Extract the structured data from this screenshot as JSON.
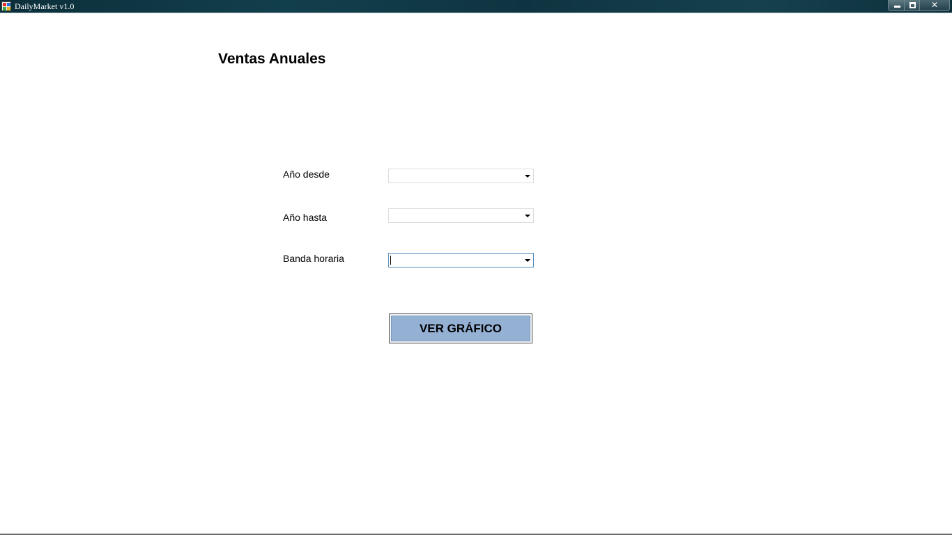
{
  "window": {
    "title": "DailyMarket v1.0",
    "controls": {
      "minimize": "minimize",
      "maximize": "restore",
      "close": "✕"
    }
  },
  "form": {
    "heading": "Ventas Anuales",
    "fields": [
      {
        "label": "Año desde",
        "value": ""
      },
      {
        "label": "Año hasta",
        "value": ""
      },
      {
        "label": "Banda horaria",
        "value": ""
      }
    ],
    "submit_label": "VER GRÁFICO"
  },
  "colors": {
    "titlebar": "#0f3441",
    "button_face": "#94b0d3",
    "focus_border": "#5b8fbf"
  }
}
